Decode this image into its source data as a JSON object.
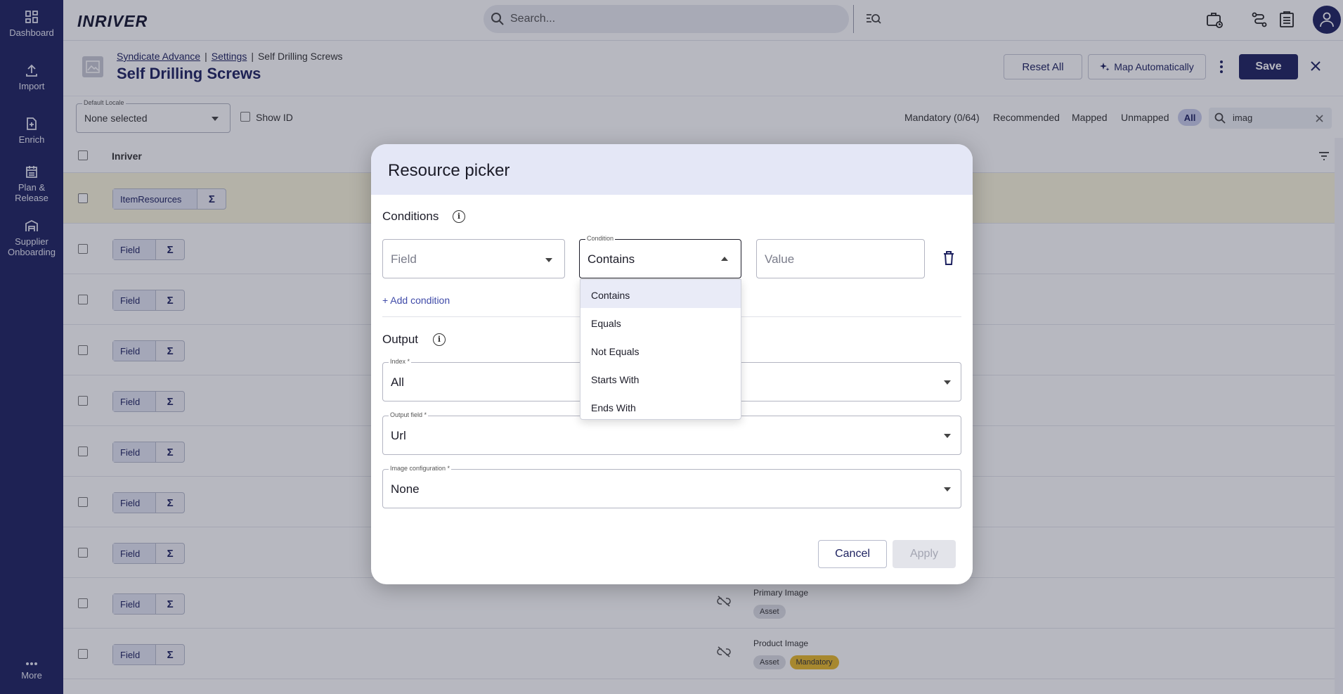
{
  "brand": "INRIVER",
  "sidebar": {
    "items": [
      {
        "label": "Dashboard",
        "icon": "dashboard-icon"
      },
      {
        "label": "Import",
        "icon": "upload-icon"
      },
      {
        "label": "Enrich",
        "icon": "document-plus-icon"
      },
      {
        "label": "Plan &",
        "label2": "Release",
        "icon": "calendar-list-icon"
      },
      {
        "label": "Supplier",
        "label2": "Onboarding",
        "icon": "warehouse-icon"
      },
      {
        "label": "More",
        "icon": "more-icon"
      }
    ]
  },
  "search": {
    "placeholder": "Search..."
  },
  "breadcrumb": {
    "items": [
      "Syndicate Advance",
      "Settings",
      "Self Drilling Screws"
    ]
  },
  "page": {
    "title": "Self Drilling Screws"
  },
  "actions": {
    "reset_all": "Reset All",
    "map_automatically": "Map Automatically",
    "save": "Save"
  },
  "filterbar": {
    "locale_label": "Default Locale",
    "locale_value": "None selected",
    "show_id": "Show ID",
    "filters": [
      "Mandatory (0/64)",
      "Recommended",
      "Mapped",
      "Unmapped",
      "All"
    ],
    "search_value": "imag"
  },
  "table": {
    "header": "Inriver",
    "first_row_pill": "ItemResources",
    "field_pill": "Field",
    "sigma": "Σ",
    "rows_right": [
      {
        "name": "Primary Image",
        "tags": [
          "Asset"
        ]
      },
      {
        "name": "Product Image",
        "tags": [
          "Asset",
          "Mandatory"
        ]
      }
    ]
  },
  "modal": {
    "title": "Resource picker",
    "conditions_title": "Conditions",
    "info_glyph": "i",
    "field_placeholder": "Field",
    "condition_label": "Condition",
    "condition_value": "Contains",
    "value_placeholder": "Value",
    "add_condition": "+ Add condition",
    "output_title": "Output",
    "index_label": "Index *",
    "index_value": "All",
    "output_field_label": "Output field *",
    "output_field_value": "Url",
    "image_config_label": "Image configuration *",
    "image_config_value": "None",
    "cancel": "Cancel",
    "apply": "Apply"
  },
  "dropdown": {
    "options": [
      "Contains",
      "Equals",
      "Not Equals",
      "Starts With",
      "Ends With"
    ],
    "selected": "Contains"
  },
  "colors": {
    "navy": "#1e2260",
    "mandatory": "#e8b82a",
    "asset": "#dcdde3"
  }
}
